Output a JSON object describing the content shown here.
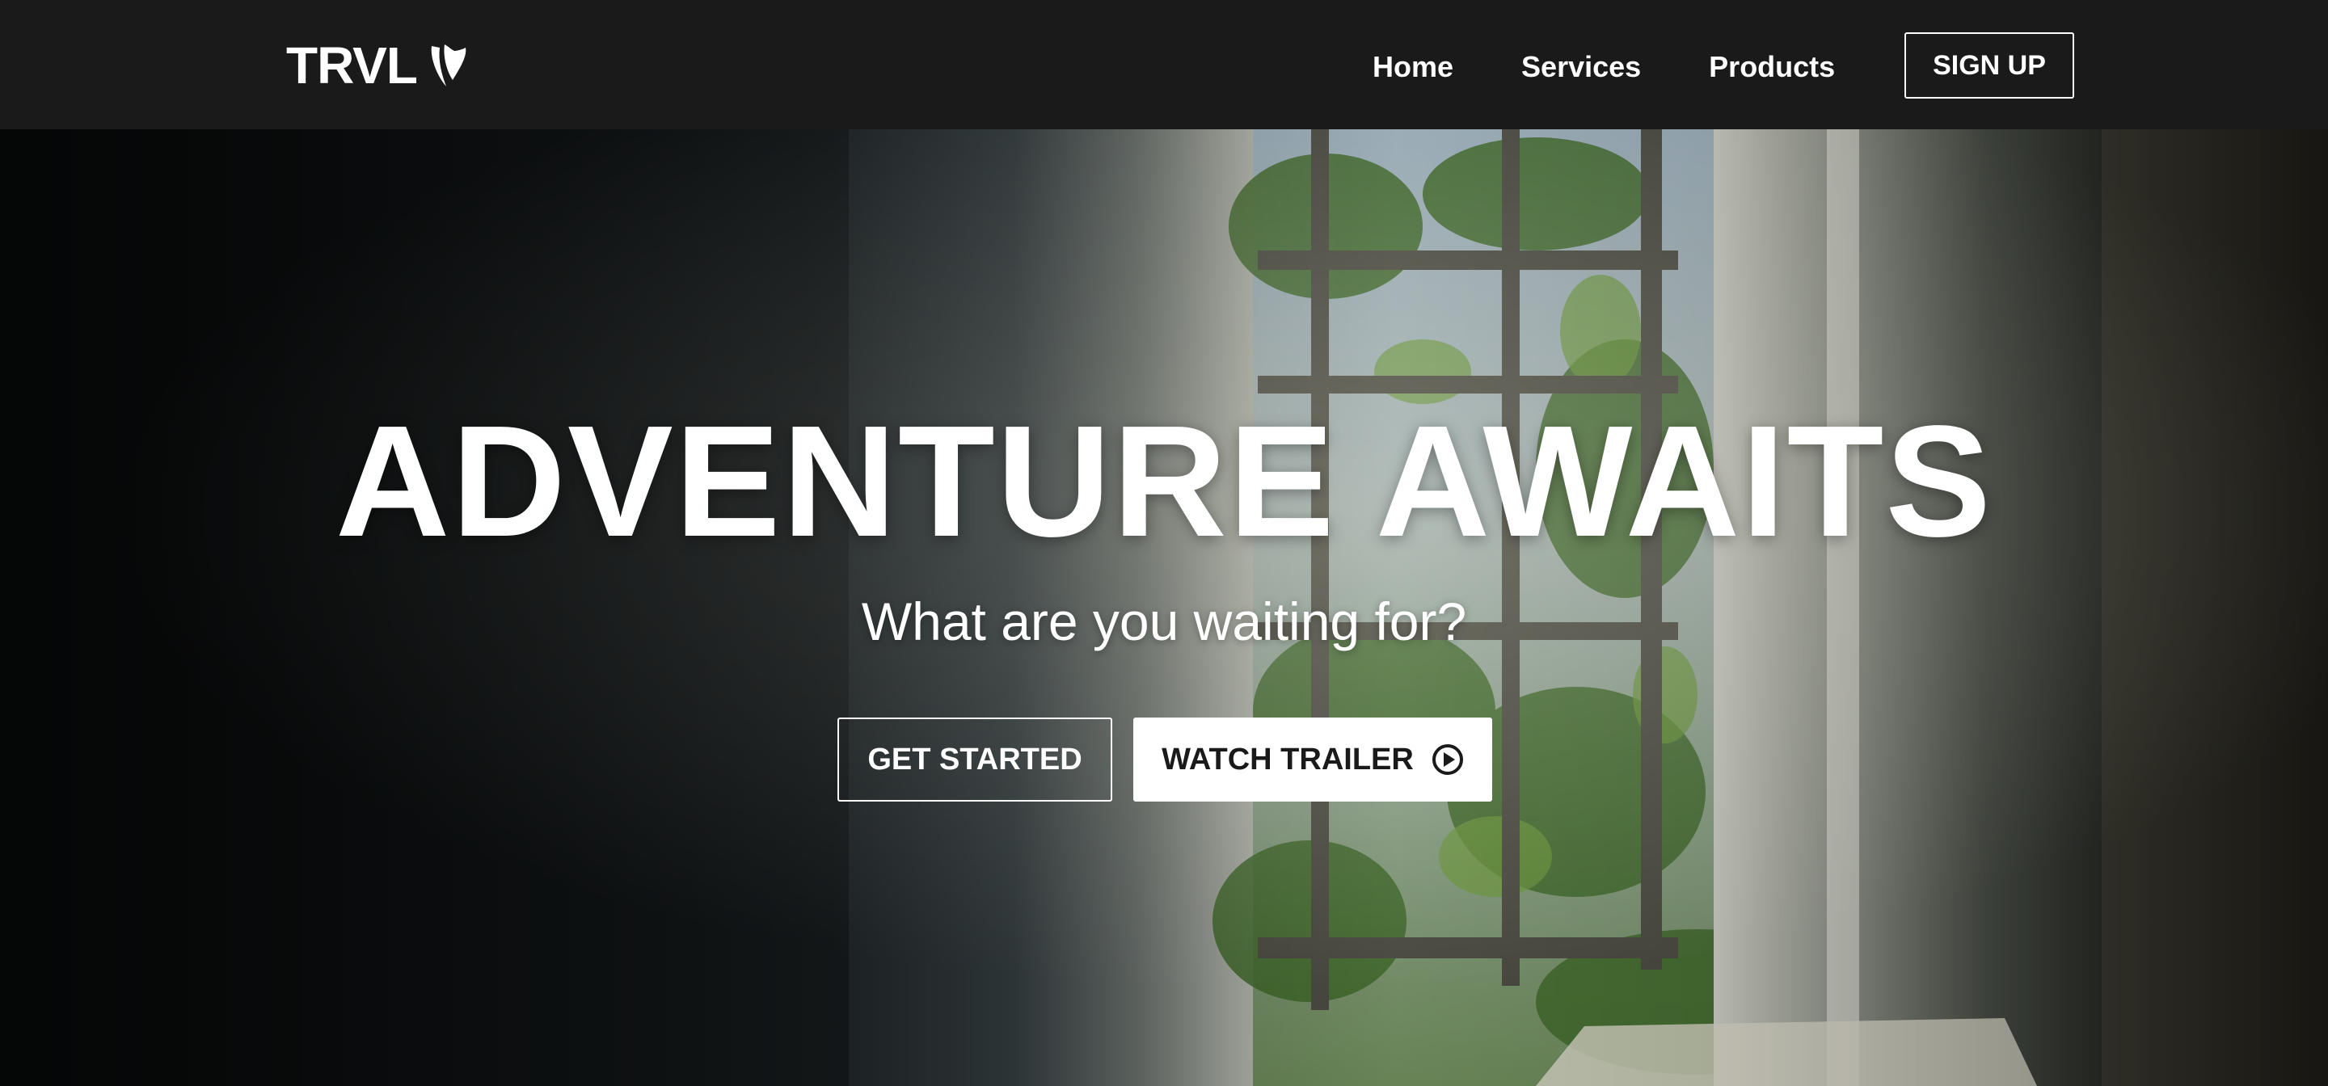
{
  "navbar": {
    "logo_text": "TRVL",
    "logo_icon": "typo3-shield-icon",
    "links": [
      {
        "label": "Home"
      },
      {
        "label": "Services"
      },
      {
        "label": "Products"
      }
    ],
    "signup_label": "SIGN UP"
  },
  "hero": {
    "title": "ADVENTURE AWAITS",
    "subtitle": "What are you waiting for?",
    "primary_button_label": "GET STARTED",
    "secondary_button_label": "WATCH TRAILER",
    "secondary_button_icon": "play-circle-icon",
    "background_image": "abandoned-room-window-with-plants"
  },
  "colors": {
    "navbar_bg": "#1b1a1b",
    "text": "#ffffff",
    "button_solid_bg": "#ffffff",
    "button_solid_text": "#1a1a1a"
  }
}
